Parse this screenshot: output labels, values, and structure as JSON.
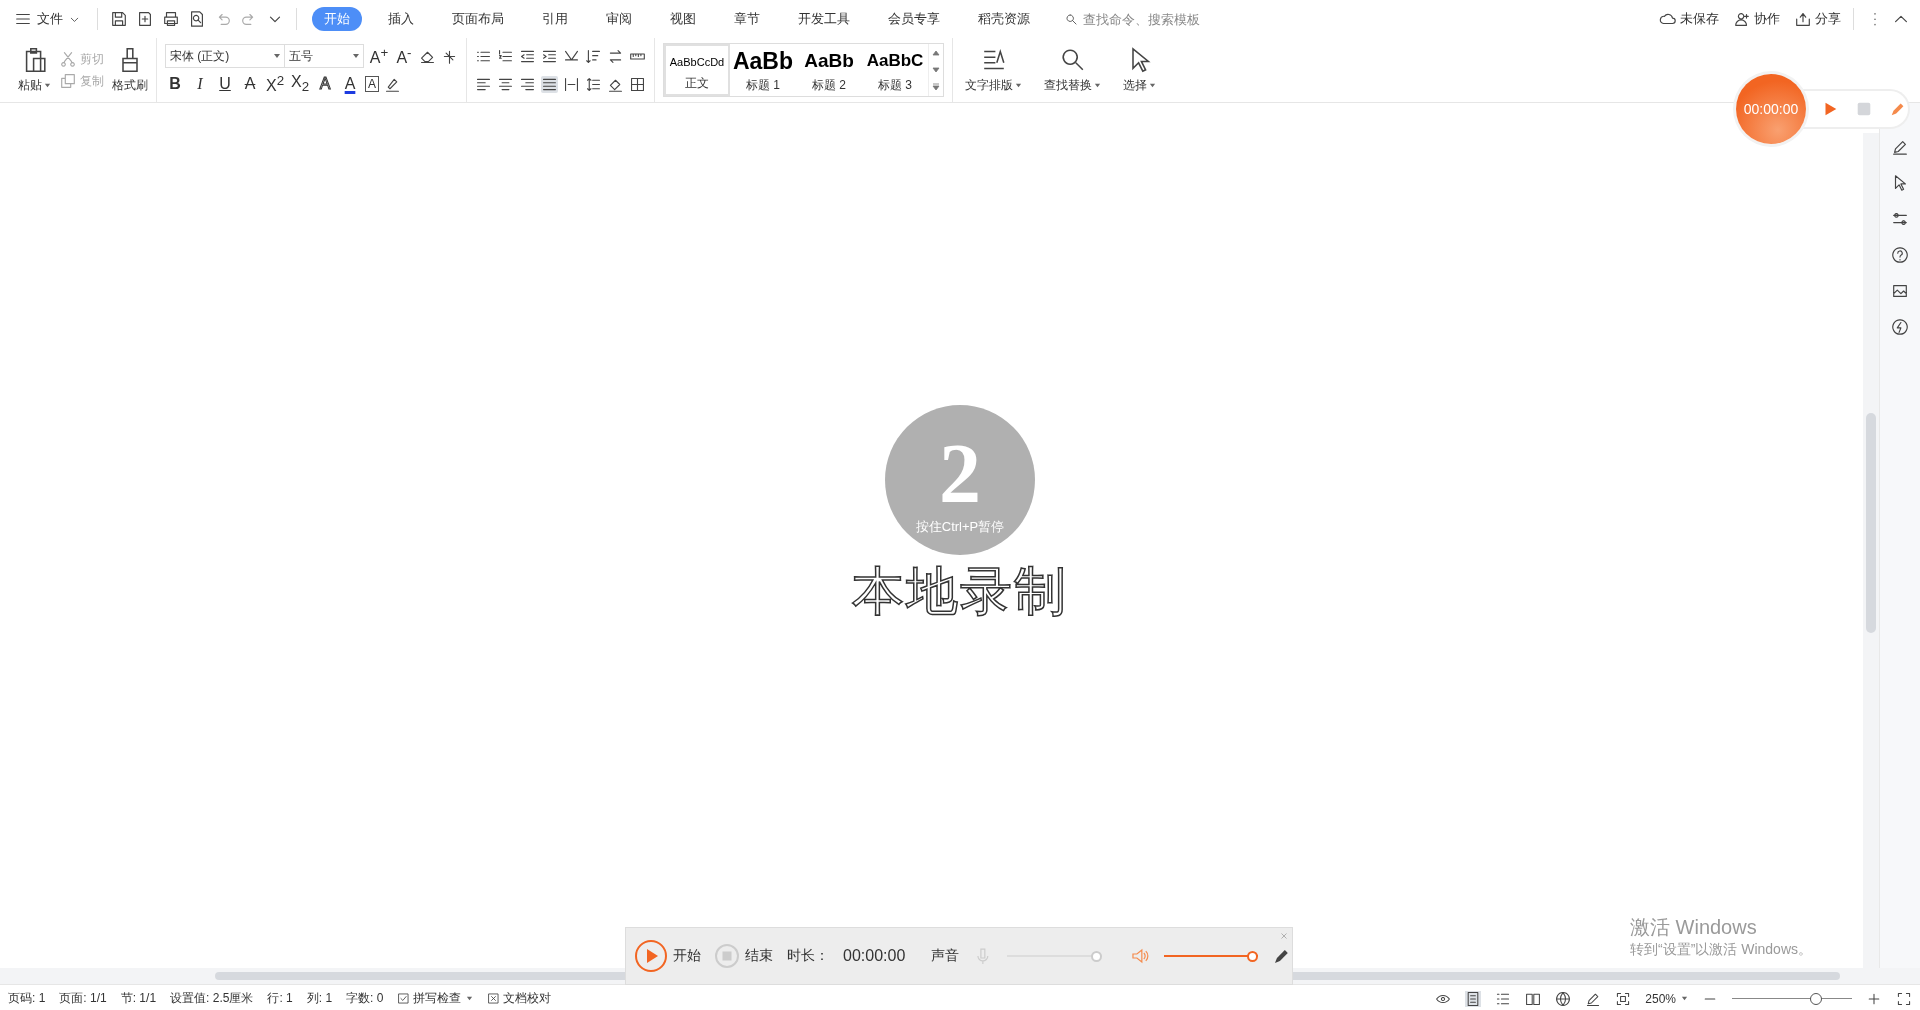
{
  "menu": {
    "label": "文件"
  },
  "tabs": [
    {
      "label": "开始",
      "selected": true
    },
    {
      "label": "插入",
      "selected": false
    },
    {
      "label": "页面布局",
      "selected": false
    },
    {
      "label": "引用",
      "selected": false
    },
    {
      "label": "审阅",
      "selected": false
    },
    {
      "label": "视图",
      "selected": false
    },
    {
      "label": "章节",
      "selected": false
    },
    {
      "label": "开发工具",
      "selected": false
    },
    {
      "label": "会员专享",
      "selected": false
    },
    {
      "label": "稻壳资源",
      "selected": false
    }
  ],
  "search": {
    "placeholder": "查找命令、搜索模板"
  },
  "header_actions": [
    "未保存",
    "协作",
    "分享"
  ],
  "clipboard": {
    "paste": "粘贴",
    "cut": {
      "label": "剪切",
      "disabled": true
    },
    "copy": {
      "label": "复制",
      "disabled": true
    },
    "format_painter": "格式刷"
  },
  "font": {
    "name": "宋体 (正文)",
    "size": "五号",
    "size_buttons": [
      "A$^{+}$",
      "A$^{-}$"
    ],
    "format_buttons": [
      {
        "label": "B",
        "kind": "bold"
      },
      {
        "label": "I",
        "kind": "italic"
      },
      {
        "label": "U",
        "kind": "underline"
      },
      {
        "label": "A",
        "kind": "strike"
      },
      {
        "label": "X$^{2}$",
        "kind": "plain"
      },
      {
        "label": "X$_{2}$",
        "kind": "plain"
      },
      {
        "label": "A",
        "kind": "outline"
      },
      {
        "label": "A",
        "kind": "color"
      },
      {
        "label": "A",
        "kind": "boxed"
      }
    ]
  },
  "alignment": [
    {
      "selected": false
    },
    {
      "selected": false
    },
    {
      "selected": false
    },
    {
      "selected": true
    },
    {
      "selected": false
    }
  ],
  "styles": [
    {
      "preview": "AaBbCcDd",
      "label": "正文",
      "kind": "body",
      "selected": true
    },
    {
      "preview": "AaBb",
      "label": "标题 1",
      "kind": "h1",
      "selected": false
    },
    {
      "preview": "AaBb",
      "label": "标题 2",
      "kind": "h2",
      "selected": false
    },
    {
      "preview": "AaBbC",
      "label": "标题 3",
      "kind": "h3",
      "selected": false
    }
  ],
  "big_buttons": [
    "文字排版",
    "查找替换",
    "选择"
  ],
  "float_recorder": {
    "time": "00:00:00"
  },
  "countdown": {
    "number": "2",
    "hint": "按住Ctrl+P暂停",
    "title": "本地录制"
  },
  "record_bar": {
    "start": "开始",
    "stop": "结束",
    "duration_label": "时长：",
    "duration": "00:00:00",
    "sound_label": "声音",
    "mic": {
      "disabled": true,
      "level": 1
    },
    "speaker": {
      "disabled": false,
      "level": 1
    }
  },
  "status": {
    "items": [
      "页码: 1",
      "页面: 1/1",
      "节: 1/1",
      "设置值: 2.5厘米",
      "行: 1",
      "列: 1",
      "字数: 0"
    ],
    "spell_check": "拼写检查",
    "proofread": "文档校对",
    "view_modes": [
      {
        "selected": true
      },
      {
        "selected": false
      },
      {
        "selected": false
      },
      {
        "selected": false
      },
      {
        "selected": false
      }
    ],
    "zoom": "250%",
    "zoom_slider": {
      "level": 0.72
    }
  },
  "os_watermark": {
    "title": "激活 Windows",
    "text": "转到“设置”以激活 Windows。"
  }
}
